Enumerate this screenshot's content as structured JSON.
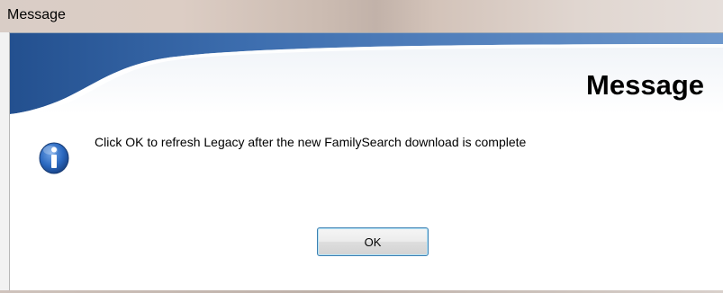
{
  "window": {
    "title": "Message"
  },
  "dialog": {
    "banner_title": "Message",
    "message": "Click OK to refresh Legacy after the new FamilySearch download is complete",
    "icon": "info-icon",
    "ok_label": "OK"
  },
  "colors": {
    "banner_blue": "#2f5f9e",
    "button_border": "#3c7fb1",
    "icon_blue": "#1f5cae"
  }
}
